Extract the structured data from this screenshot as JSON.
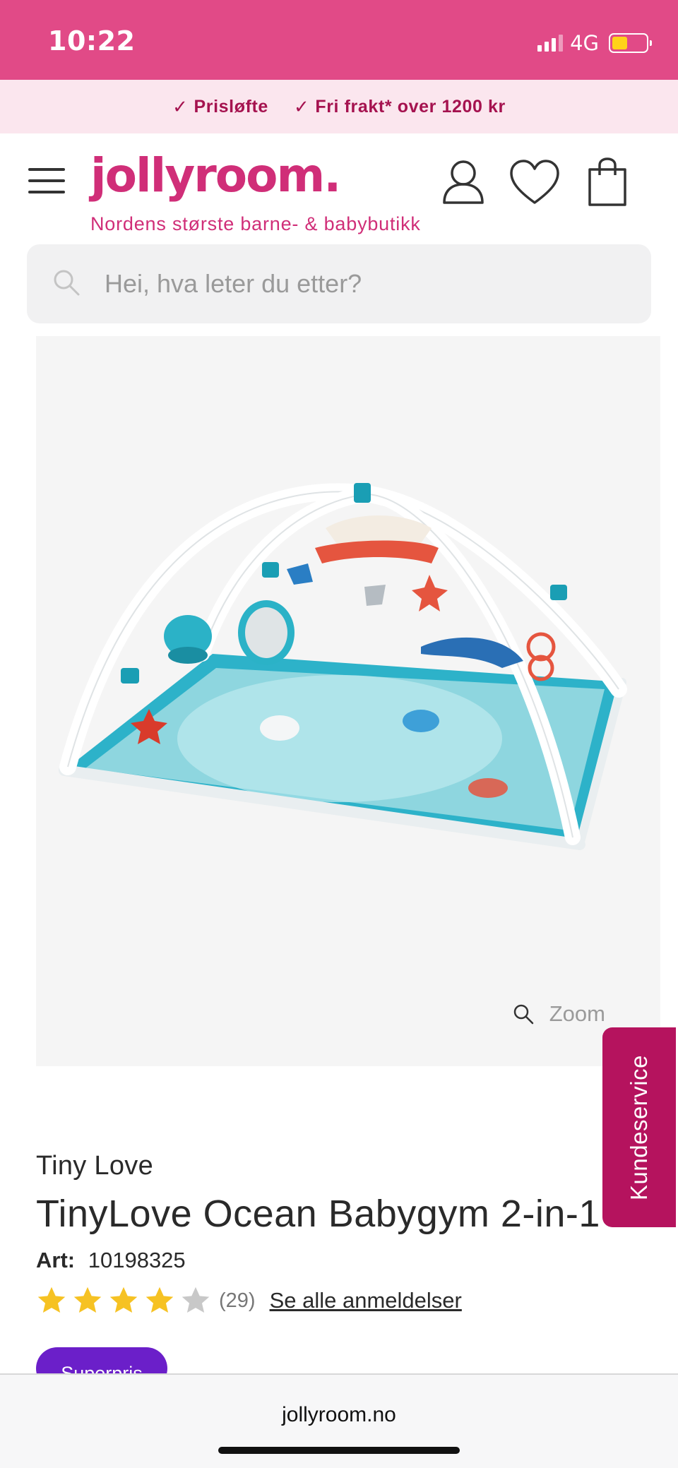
{
  "status_bar": {
    "time": "10:22",
    "network": "4G",
    "battery_level": 0.45,
    "signal_bars": 3,
    "background": "#e14a87"
  },
  "usp_bar": {
    "items": [
      "Prisløfte",
      "Fri frakt* over 1200 kr"
    ],
    "icon": "check-icon"
  },
  "header": {
    "logo": "jollyroom.",
    "tagline": "Nordens største barne- & babybutikk",
    "brand_color": "#d02e78",
    "icons": [
      "menu-icon",
      "account-icon",
      "heart-icon",
      "shopping-bag-icon"
    ]
  },
  "search": {
    "placeholder": "Hei, hva leter du etter?",
    "icon": "search-icon"
  },
  "product_image": {
    "zoom_label": "Zoom",
    "icon": "magnifier-icon"
  },
  "customer_service": {
    "label": "Kundeservice",
    "color": "#b5135e"
  },
  "product": {
    "brand": "Tiny Love",
    "title": "TinyLove Ocean Babygym 2-in-1",
    "art_label": "Art:",
    "art_number": "10198325",
    "rating": 4,
    "rating_max": 5,
    "review_count": "(29)",
    "all_reviews_label": "Se alle anmeldelser",
    "badge": "Superpris",
    "badge_color": "#6b1fc9"
  },
  "browser": {
    "url": "jollyroom.no"
  }
}
